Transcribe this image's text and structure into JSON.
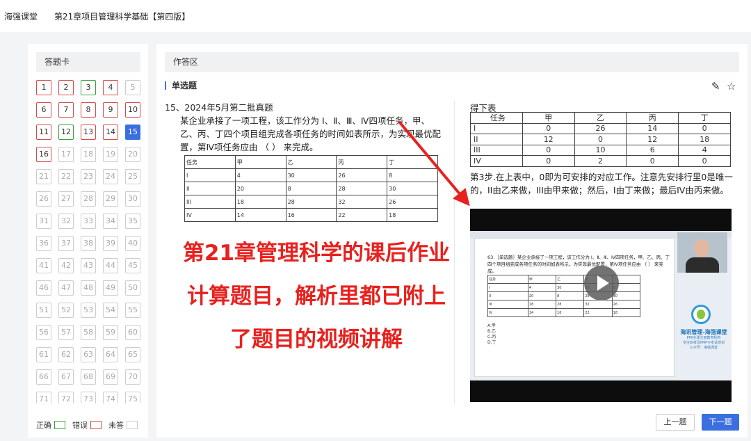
{
  "topbar": {
    "brand": "海强课堂",
    "course": "第21章项目管理科学基础【第四版】"
  },
  "card": {
    "title": "答题卡",
    "questions": [
      {
        "n": "1",
        "s": "wrong"
      },
      {
        "n": "2",
        "s": "wrong"
      },
      {
        "n": "3",
        "s": "right"
      },
      {
        "n": "4",
        "s": "wrong"
      },
      {
        "n": "5",
        "s": "none"
      },
      {
        "n": "6",
        "s": "wrong"
      },
      {
        "n": "7",
        "s": "wrong"
      },
      {
        "n": "8",
        "s": "wrong"
      },
      {
        "n": "9",
        "s": "wrong"
      },
      {
        "n": "10",
        "s": "wrong"
      },
      {
        "n": "11",
        "s": "wrong"
      },
      {
        "n": "12",
        "s": "right"
      },
      {
        "n": "13",
        "s": "wrong"
      },
      {
        "n": "14",
        "s": "wrong"
      },
      {
        "n": "15",
        "s": "current"
      },
      {
        "n": "16",
        "s": "wrong"
      },
      {
        "n": "17",
        "s": "none"
      },
      {
        "n": "18",
        "s": "none"
      },
      {
        "n": "19",
        "s": "none"
      },
      {
        "n": "20",
        "s": "none"
      },
      {
        "n": "21",
        "s": "none"
      },
      {
        "n": "22",
        "s": "none"
      },
      {
        "n": "23",
        "s": "none"
      },
      {
        "n": "24",
        "s": "none"
      },
      {
        "n": "25",
        "s": "none"
      },
      {
        "n": "26",
        "s": "none"
      },
      {
        "n": "27",
        "s": "none"
      },
      {
        "n": "28",
        "s": "none"
      },
      {
        "n": "29",
        "s": "none"
      },
      {
        "n": "30",
        "s": "none"
      },
      {
        "n": "31",
        "s": "none"
      },
      {
        "n": "32",
        "s": "none"
      },
      {
        "n": "33",
        "s": "none"
      },
      {
        "n": "34",
        "s": "none"
      },
      {
        "n": "35",
        "s": "none"
      },
      {
        "n": "36",
        "s": "none"
      },
      {
        "n": "37",
        "s": "none"
      },
      {
        "n": "38",
        "s": "none"
      },
      {
        "n": "39",
        "s": "none"
      },
      {
        "n": "40",
        "s": "none"
      },
      {
        "n": "41",
        "s": "none"
      },
      {
        "n": "42",
        "s": "none"
      },
      {
        "n": "43",
        "s": "none"
      },
      {
        "n": "44",
        "s": "none"
      },
      {
        "n": "45",
        "s": "none"
      },
      {
        "n": "46",
        "s": "none"
      },
      {
        "n": "47",
        "s": "none"
      },
      {
        "n": "48",
        "s": "none"
      },
      {
        "n": "49",
        "s": "none"
      },
      {
        "n": "50",
        "s": "none"
      },
      {
        "n": "51",
        "s": "none"
      },
      {
        "n": "52",
        "s": "none"
      },
      {
        "n": "53",
        "s": "none"
      },
      {
        "n": "54",
        "s": "none"
      },
      {
        "n": "55",
        "s": "none"
      },
      {
        "n": "56",
        "s": "none"
      },
      {
        "n": "57",
        "s": "none"
      },
      {
        "n": "58",
        "s": "none"
      },
      {
        "n": "59",
        "s": "none"
      },
      {
        "n": "60",
        "s": "none"
      },
      {
        "n": "61",
        "s": "none"
      },
      {
        "n": "62",
        "s": "none"
      },
      {
        "n": "63",
        "s": "none"
      },
      {
        "n": "64",
        "s": "none"
      },
      {
        "n": "65",
        "s": "none"
      },
      {
        "n": "66",
        "s": "none"
      },
      {
        "n": "67",
        "s": "none"
      },
      {
        "n": "68",
        "s": "none"
      },
      {
        "n": "69",
        "s": "none"
      },
      {
        "n": "70",
        "s": "none"
      },
      {
        "n": "71",
        "s": "none"
      },
      {
        "n": "72",
        "s": "none"
      },
      {
        "n": "73",
        "s": "none"
      },
      {
        "n": "74",
        "s": "none"
      },
      {
        "n": "75",
        "s": "none"
      }
    ],
    "legend": {
      "correct": "正确",
      "wrong": "错误",
      "unanswered": "未答"
    }
  },
  "answer": {
    "title": "作答区",
    "type": "单选题",
    "icons": {
      "pin": "pin-icon",
      "star": "star-icon"
    },
    "question_number": "15、2024年5月第二批真题",
    "stem": "某企业承接了一项工程，该工作分为 Ⅰ、Ⅱ、Ⅲ、Ⅳ四项任务，甲、乙、丙、丁四个项目组完成各项任务的时间如表所示，为实现最优配置，第Ⅳ项任务应由 （ ） 来完成。",
    "table": [
      [
        "任务",
        "甲",
        "乙",
        "丙",
        "丁"
      ],
      [
        "I",
        "4",
        "30",
        "26",
        "8"
      ],
      [
        "II",
        "20",
        "8",
        "28",
        "30"
      ],
      [
        "III",
        "18",
        "28",
        "32",
        "26"
      ],
      [
        "IV",
        "14",
        "16",
        "22",
        "18"
      ]
    ],
    "right_top": "得下表",
    "right_table": [
      [
        "任务",
        "甲",
        "乙",
        "丙",
        "丁"
      ],
      [
        "I",
        "0",
        "26",
        "14",
        "0"
      ],
      [
        "II",
        "12",
        "0",
        "12",
        "18"
      ],
      [
        "III",
        "0",
        "10",
        "6",
        "4"
      ],
      [
        "IV",
        "0",
        "2",
        "0",
        "0"
      ]
    ],
    "step3": "第3步.在上表中，0即为可安排的对应工作。注意先安排行里0是唯一的，II由乙来做，III由甲来做；然后，I由丁来做；最后IV由丙来做。",
    "overlay": [
      "第21章管理科学的课后作业",
      "计算题目，解析里都已附上",
      "了题目的视频讲解"
    ],
    "video": {
      "doc_text": "63.［单选题］某企业承接了一项工程，该工作分为 Ⅰ、Ⅱ、Ⅲ、Ⅳ四项任务，甲、乙、丙、丁四个项目组完成各项任务的时间如表所示，为实现最优配置，第Ⅳ项任务应由 （ ） 来完成。",
      "options": [
        "A.甲",
        "B.乙",
        "C.丙",
        "D.丁"
      ],
      "brand_title": "海讯管理-海强课堂",
      "brand_sub1": "PMI全球注册教育机构",
      "brand_sub2": "专注软考及PMP®考试培训",
      "brand_sub3": "公众号：海强课堂"
    },
    "prev": "上一题",
    "next": "下一题"
  },
  "colors": {
    "accent": "#3b6fe0",
    "wrong": "#d84a4a",
    "right": "#3aa03a",
    "overlay_text": "#e8211e"
  }
}
